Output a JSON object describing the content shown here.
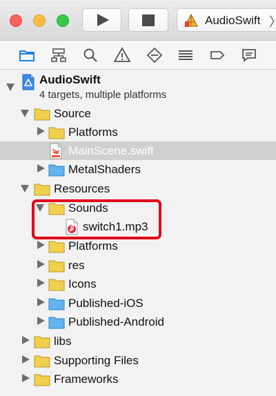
{
  "toolbar": {
    "scheme_label": "AudioSwift",
    "scheme_chevron": "〉",
    "icons": [
      "close-button",
      "minimize-button",
      "zoom-button",
      "play-icon",
      "stop-icon",
      "app-store-icon"
    ]
  },
  "navigator_tabs": [
    "folder-icon",
    "hierarchy-icon",
    "search-icon",
    "warning-icon",
    "test-diamond-icon",
    "list-icon",
    "tag-icon",
    "chat-icon"
  ],
  "project": {
    "name": "AudioSwift",
    "subtitle": "4 targets, multiple platforms"
  },
  "tree": [
    {
      "label": "Source",
      "level": 1,
      "expanded": true,
      "kind": "folder-yellow"
    },
    {
      "label": "Platforms",
      "level": 2,
      "expanded": false,
      "kind": "folder-yellow"
    },
    {
      "label": "MainScene.swift",
      "level": 2,
      "kind": "swift-file",
      "selected": true
    },
    {
      "label": "MetalShaders",
      "level": 2,
      "expanded": false,
      "kind": "folder-blue"
    },
    {
      "label": "Resources",
      "level": 1,
      "expanded": true,
      "kind": "folder-yellow"
    },
    {
      "label": "Sounds",
      "level": 2,
      "expanded": true,
      "kind": "folder-yellow"
    },
    {
      "label": "switch1.mp3",
      "level": 3,
      "kind": "audio-file"
    },
    {
      "label": "Platforms",
      "level": 2,
      "expanded": false,
      "kind": "folder-yellow"
    },
    {
      "label": "res",
      "level": 2,
      "expanded": false,
      "kind": "folder-yellow"
    },
    {
      "label": "Icons",
      "level": 2,
      "expanded": false,
      "kind": "folder-yellow"
    },
    {
      "label": "Published-iOS",
      "level": 2,
      "expanded": false,
      "kind": "folder-blue"
    },
    {
      "label": "Published-Android",
      "level": 2,
      "expanded": false,
      "kind": "folder-blue"
    },
    {
      "label": "libs",
      "level": 1,
      "expanded": false,
      "kind": "folder-yellow"
    },
    {
      "label": "Supporting Files",
      "level": 1,
      "expanded": false,
      "kind": "folder-yellow"
    },
    {
      "label": "Frameworks",
      "level": 1,
      "expanded": false,
      "kind": "folder-yellow"
    }
  ],
  "colors": {
    "accent_nav": "#1e7ee8",
    "folder_yellow": "#f0d04c",
    "folder_blue": "#62b3ee",
    "highlight": "#e2001a",
    "selection": "#d0d0d0"
  }
}
